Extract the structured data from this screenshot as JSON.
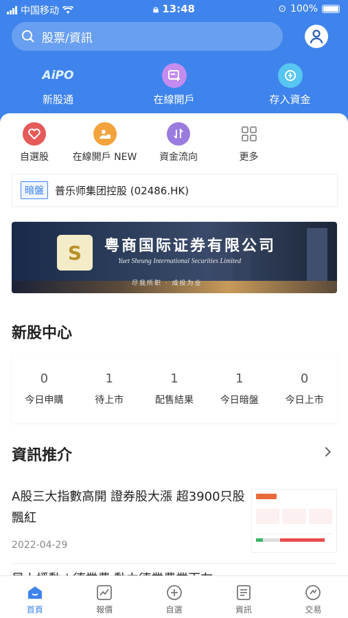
{
  "status": {
    "carrier": "中国移动",
    "time": "13:48",
    "battery": "100%"
  },
  "search": {
    "placeholder": "股票/資訊"
  },
  "top_nav": [
    {
      "label": "新股通",
      "icon": "aipo-icon",
      "icon_text": "AiPO"
    },
    {
      "label": "在線開戶",
      "icon": "open-account-icon"
    },
    {
      "label": "存入資金",
      "icon": "deposit-icon"
    }
  ],
  "quick": [
    {
      "label": "自選股",
      "icon": "heart-icon",
      "color": "#e65a5a"
    },
    {
      "label": "在線開戶 NEW",
      "icon": "person-lock-icon",
      "color": "#f2a33c"
    },
    {
      "label": "資金流向",
      "icon": "flow-icon",
      "color": "#9a7be0"
    },
    {
      "label": "更多",
      "icon": "grid-icon",
      "color": "#888888"
    }
  ],
  "dark_pool": {
    "tag": "暗盤",
    "name": "普乐师集团控股 (02486.HK)"
  },
  "banner": {
    "title": "粤商国际证券有限公司",
    "subtitle": "Yuet Sheung International Securities Limited",
    "slogan": "尽我所职 · 成投为业"
  },
  "ipo_center": {
    "title": "新股中心",
    "items": [
      {
        "value": "0",
        "label": "今日申購"
      },
      {
        "value": "1",
        "label": "待上市"
      },
      {
        "value": "1",
        "label": "配售結果"
      },
      {
        "value": "1",
        "label": "今日暗盤"
      },
      {
        "value": "0",
        "label": "今日上市"
      }
    ]
  },
  "news": {
    "title": "資訊推介",
    "items": [
      {
        "headline": "A股三大指數高開 證券股大漲 超3900只股飄紅",
        "date": "2022-04-29"
      }
    ],
    "partial": "早上播動 | 德業費 動力德業費業百在"
  },
  "tabbar": [
    {
      "label": "首頁",
      "icon": "home-icon",
      "active": true
    },
    {
      "label": "報價",
      "icon": "quote-icon",
      "active": false
    },
    {
      "label": "自選",
      "icon": "add-icon",
      "active": false
    },
    {
      "label": "資訊",
      "icon": "news-icon",
      "active": false
    },
    {
      "label": "交易",
      "icon": "trade-icon",
      "active": false
    }
  ],
  "colors": {
    "brand": "#3f84ec"
  }
}
